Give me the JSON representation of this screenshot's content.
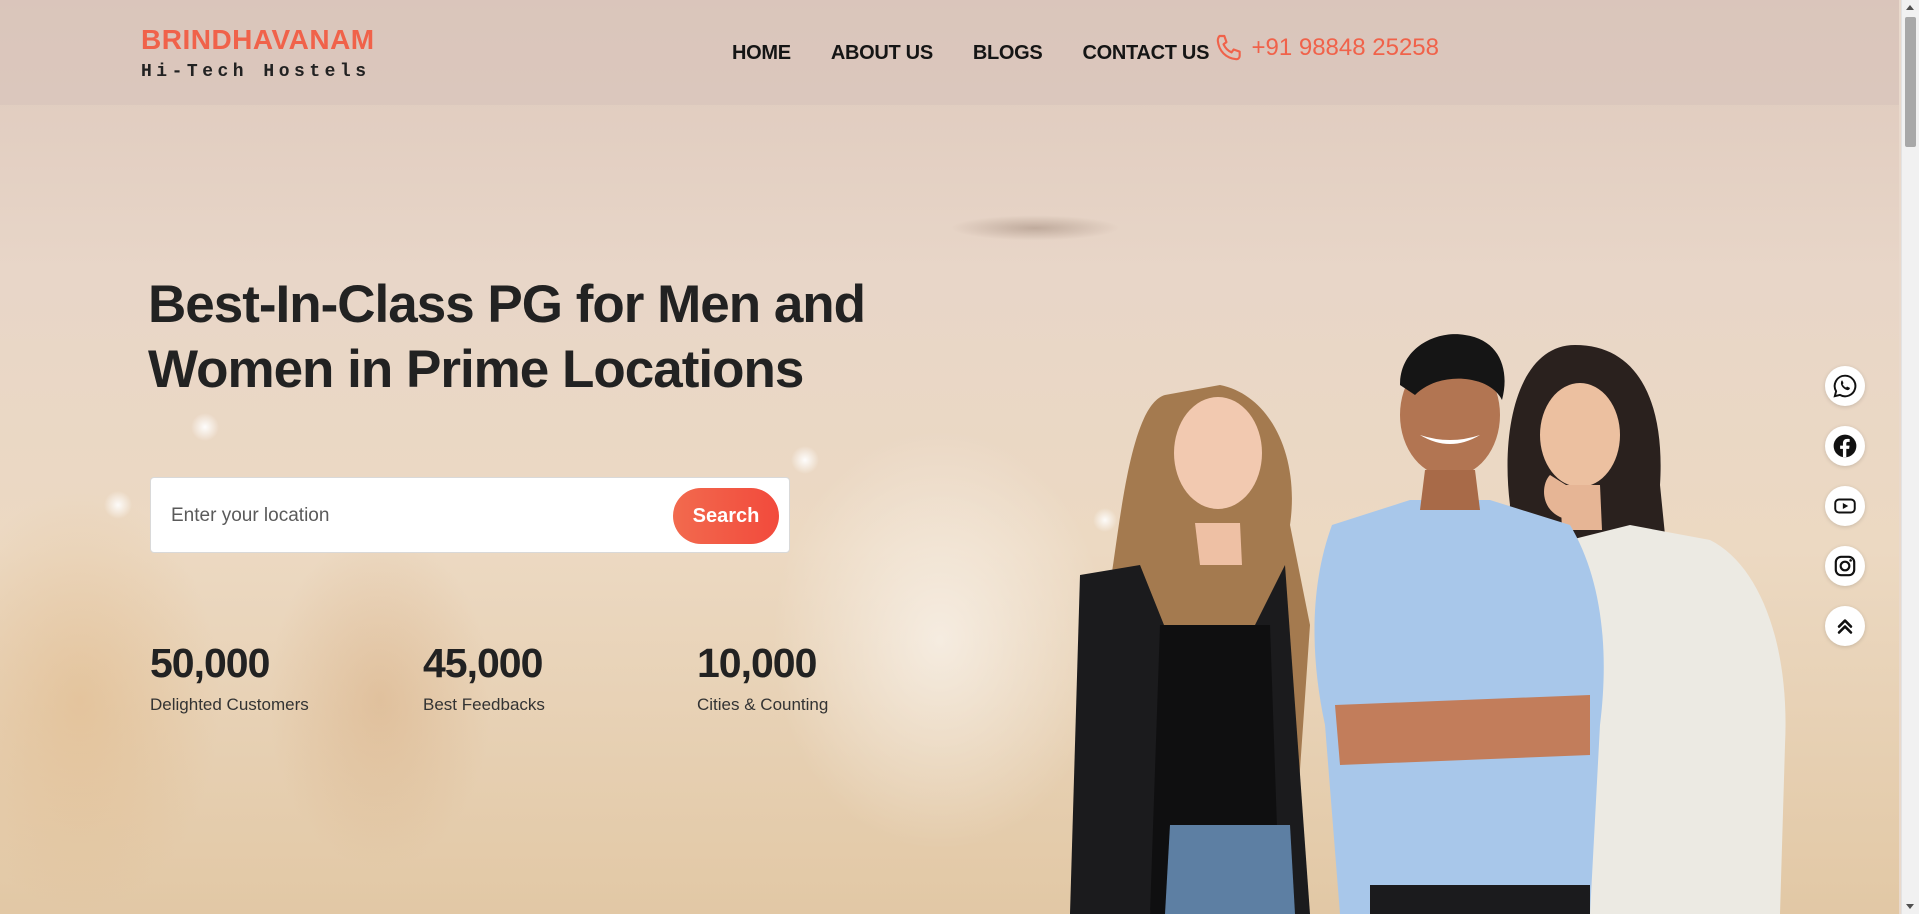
{
  "header": {
    "brand_name": "BRINDHAVANAM",
    "brand_tagline": "Hi-Tech Hostels",
    "nav": [
      {
        "label": "HOME"
      },
      {
        "label": "ABOUT US"
      },
      {
        "label": "BLOGS"
      },
      {
        "label": "CONTACT US"
      }
    ],
    "phone": "+91 98848 25258"
  },
  "hero": {
    "headline_line1": "Best-In-Class PG for Men and",
    "headline_line2": "Women in Prime Locations",
    "search": {
      "placeholder": "Enter your location",
      "value": "",
      "button_label": "Search"
    },
    "stats": [
      {
        "value": "50,000",
        "label": "Delighted Customers"
      },
      {
        "value": "45,000",
        "label": "Best Feedbacks"
      },
      {
        "value": "10,000",
        "label": "Cities & Counting"
      }
    ]
  },
  "social_icons": [
    "whatsapp-icon",
    "facebook-icon",
    "youtube-icon",
    "instagram-icon",
    "scroll-top-icon"
  ],
  "colors": {
    "accent": "#f0624a",
    "text_dark": "#222222",
    "search_button": "#f24a3c"
  }
}
